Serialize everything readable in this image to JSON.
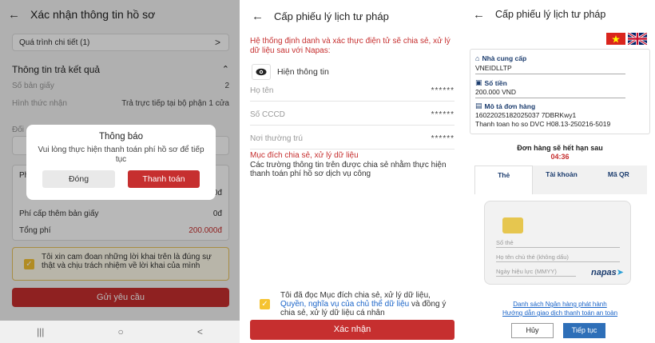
{
  "screen1": {
    "title": "Xác nhận thông tin hồ sơ",
    "process_detail": "Quá trình chi tiết (1)",
    "result_section": "Thông tin trả kết quả",
    "copies_label": "Số bản giấy",
    "copies_value": "2",
    "method_label": "Hình thức nhận",
    "method_value": "Trả trực tiếp tại bộ phận 1 cửa",
    "partial_label": "Đối",
    "partial_row_label": "Ph",
    "partial_row_value": "0đ",
    "extra_fee_label": "Phí cấp thêm bản giấy",
    "extra_fee_value": "0đ",
    "total_label": "Tổng phí",
    "total_value": "200.000đ",
    "commitment": "Tôi xin cam đoan những lời khai trên là đúng sự thật và chịu trách nhiệm về lời khai của mình",
    "submit": "Gửi yêu cầu",
    "modal": {
      "title": "Thông báo",
      "message": "Vui lòng thực hiện thanh toán phí hồ sơ để tiếp tục",
      "cancel": "Đóng",
      "confirm": "Thanh toán"
    },
    "nav": {
      "recent": "|||",
      "home": "○",
      "back": "<"
    }
  },
  "screen2": {
    "title": "Cấp phiếu lý lịch tư pháp",
    "intro": "Hệ thống định danh và xác thực điện tử sẽ chia sẻ, xử lý dữ liệu sau với Napas:",
    "show_info": "Hiện thông tin",
    "fields": [
      {
        "label": "Họ tên",
        "value": "******"
      },
      {
        "label": "Số CCCD",
        "value": "******"
      },
      {
        "label": "Nơi thường trú",
        "value": "******"
      }
    ],
    "purpose_title": "Mục đích chia sẻ, xử lý dữ liệu",
    "purpose_text": "Các trường thông tin trên được chia sẻ nhằm thực hiện thanh toán phí hồ sơ dịch vụ công",
    "agree_prefix": "Tôi đã đọc Mục đích chia sẻ, xử lý dữ liệu,",
    "agree_link": "Quyền, nghĩa vụ của chủ thể dữ liệu",
    "agree_suffix": "và đồng ý chia sẻ, xử lý dữ liệu cá nhân",
    "confirm": "Xác nhận"
  },
  "screen3": {
    "title": "Cấp phiếu lý lịch tư pháp",
    "provider_label": "Nhà cung cấp",
    "provider_value": "VNEIDLLTP",
    "amount_label": "Số tiền",
    "amount_value": "200.000 VND",
    "desc_label": "Mô tả đơn hàng",
    "desc_line1": "16022025182025037 7DBRKwy1",
    "desc_line2": "Thanh toan ho so DVC H08.13-250216-5019",
    "expire_label": "Đơn hàng sẽ hết hạn sau",
    "timer": "04:36",
    "tabs": [
      "Thẻ",
      "Tài khoản",
      "Mã QR"
    ],
    "card_number": "Số thẻ",
    "card_holder": "Họ tên chủ thẻ (không dấu)",
    "card_date": "Ngày hiệu lực (MMYY)",
    "brand": "napas",
    "bank_list": "Danh sách Ngân hàng phát hành",
    "safe_guide": "Hướng dẫn giao dịch thanh toán an toàn",
    "cancel": "Hủy",
    "continue": "Tiếp tục"
  },
  "colors": {
    "primary_red": "#c62f2f",
    "napas_blue": "#1b3c6e",
    "link_blue": "#1a64c8",
    "checkbox_yellow": "#f5c331"
  }
}
